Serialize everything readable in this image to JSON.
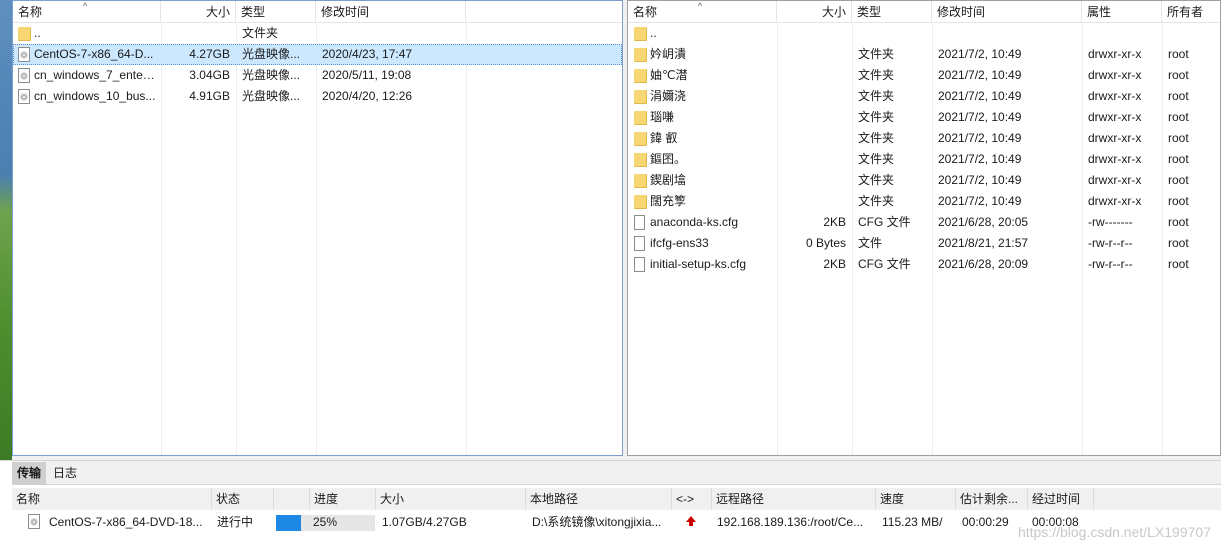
{
  "local": {
    "columns": {
      "name": "名称",
      "size": "大小",
      "type": "类型",
      "modified": "修改时间"
    },
    "rows": [
      {
        "icon": "folder-icon",
        "name": "..",
        "size": "",
        "type": "文件夹",
        "modified": "",
        "selected": false
      },
      {
        "icon": "disc-image-icon",
        "name": "CentOS-7-x86_64-D...",
        "size": "4.27GB",
        "type": "光盘映像...",
        "modified": "2020/4/23, 17:47",
        "selected": true
      },
      {
        "icon": "disc-image-icon",
        "name": "cn_windows_7_enter...",
        "size": "3.04GB",
        "type": "光盘映像...",
        "modified": "2020/5/11, 19:08",
        "selected": false
      },
      {
        "icon": "disc-image-icon",
        "name": "cn_windows_10_bus...",
        "size": "4.91GB",
        "type": "光盘映像...",
        "modified": "2020/4/20, 12:26",
        "selected": false
      }
    ]
  },
  "remote": {
    "columns": {
      "name": "名称",
      "size": "大小",
      "type": "类型",
      "modified": "修改时间",
      "attr": "属性",
      "owner": "所有者"
    },
    "rows": [
      {
        "icon": "folder-icon",
        "name": "..",
        "size": "",
        "type": "",
        "modified": "",
        "attr": "",
        "owner": ""
      },
      {
        "icon": "folder-icon",
        "name": "妗岄潰",
        "size": "",
        "type": "文件夹",
        "modified": "2021/7/2, 10:49",
        "attr": "drwxr-xr-x",
        "owner": "root"
      },
      {
        "icon": "folder-icon",
        "name": "妯℃澘",
        "size": "",
        "type": "文件夹",
        "modified": "2021/7/2, 10:49",
        "attr": "drwxr-xr-x",
        "owner": "root"
      },
      {
        "icon": "folder-icon",
        "name": "涓嬭浇",
        "size": "",
        "type": "文件夹",
        "modified": "2021/7/2, 10:49",
        "attr": "drwxr-xr-x",
        "owner": "root"
      },
      {
        "icon": "folder-icon",
        "name": "瑙嗛",
        "size": "",
        "type": "文件夹",
        "modified": "2021/7/2, 10:49",
        "attr": "drwxr-xr-x",
        "owner": "root"
      },
      {
        "icon": "folder-icon",
        "name": "鍏  叡",
        "size": "",
        "type": "文件夹",
        "modified": "2021/7/2, 10:49",
        "attr": "drwxr-xr-x",
        "owner": "root"
      },
      {
        "icon": "folder-icon",
        "name": "鏂囨。",
        "size": "",
        "type": "文件夹",
        "modified": "2021/7/2, 10:49",
        "attr": "drwxr-xr-x",
        "owner": "root"
      },
      {
        "icon": "folder-icon",
        "name": "鍥剧墖",
        "size": "",
        "type": "文件夹",
        "modified": "2021/7/2, 10:49",
        "attr": "drwxr-xr-x",
        "owner": "root"
      },
      {
        "icon": "folder-icon",
        "name": "闊充箰",
        "size": "",
        "type": "文件夹",
        "modified": "2021/7/2, 10:49",
        "attr": "drwxr-xr-x",
        "owner": "root"
      },
      {
        "icon": "file-icon",
        "name": "anaconda-ks.cfg",
        "size": "2KB",
        "type": "CFG 文件",
        "modified": "2021/6/28, 20:05",
        "attr": "-rw-------",
        "owner": "root"
      },
      {
        "icon": "file-icon",
        "name": "ifcfg-ens33",
        "size": "0 Bytes",
        "type": "文件",
        "modified": "2021/8/21, 21:57",
        "attr": "-rw-r--r--",
        "owner": "root"
      },
      {
        "icon": "file-icon",
        "name": "initial-setup-ks.cfg",
        "size": "2KB",
        "type": "CFG 文件",
        "modified": "2021/6/28, 20:09",
        "attr": "-rw-r--r--",
        "owner": "root"
      }
    ]
  },
  "transfer": {
    "tabs": [
      "传输",
      "日志"
    ],
    "columns": {
      "name": "名称",
      "status": "状态",
      "progress": "进度",
      "size": "大小",
      "local_path": "本地路径",
      "direction": "<->",
      "remote_path": "远程路径",
      "speed": "速度",
      "eta": "估计剩余...",
      "elapsed": "经过时间"
    },
    "row": {
      "icon": "disc-image-icon",
      "name": "CentOS-7-x86_64-DVD-18...",
      "status": "进行中",
      "progress_fraction": 0.25,
      "progress_text": "25%",
      "size": "1.07GB/4.27GB",
      "local_path": "D:\\系统镜像\\xitongjixia...",
      "direction_icon": "upload-arrow-icon",
      "remote_path": "192.168.189.136:/root/Ce...",
      "speed": "115.23 MB/",
      "eta": "00:00:29",
      "elapsed": "00:00:08"
    },
    "progress_color": "#1e88e5",
    "direction_color": "#cc0000"
  },
  "watermark": "https://blog.csdn.net/LX199707"
}
